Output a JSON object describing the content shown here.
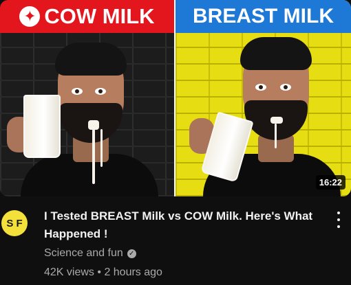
{
  "video": {
    "thumbnail": {
      "left_label": "COW MILK",
      "right_label": "BREAST MILK",
      "left_icon": "sparkle-icon",
      "duration": "16:22",
      "colors": {
        "left_banner": "#e4161d",
        "right_banner": "#1e78d6",
        "right_wall": "#e6de12",
        "left_wall": "#1c1c1c"
      }
    },
    "title": "I Tested BREAST Milk vs COW Milk. Here's What Happened !",
    "channel": {
      "name": "Science and fun",
      "avatar_text": "S F",
      "verified_icon": "verified-check-icon"
    },
    "views": "42K views",
    "separator": "•",
    "age": "2 hours ago",
    "menu_icon": "more-vertical-icon"
  }
}
